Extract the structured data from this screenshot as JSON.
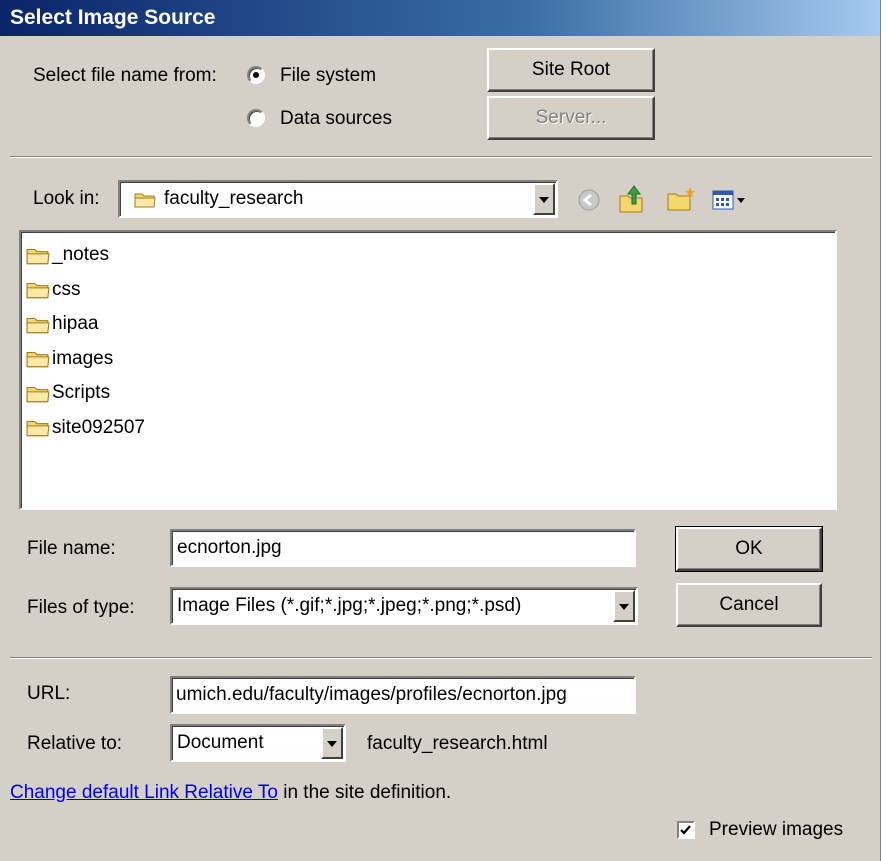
{
  "title": "Select Image Source",
  "select_from": {
    "label": "Select file name from:",
    "options": [
      "File system",
      "Data sources"
    ],
    "selected": "File system"
  },
  "buttons": {
    "site_root": "Site Root",
    "server": "Server...",
    "ok": "OK",
    "cancel": "Cancel"
  },
  "look_in": {
    "label": "Look in:",
    "value": "faculty_research"
  },
  "toolbar_icons": [
    "back-icon",
    "up-folder-icon",
    "new-folder-icon",
    "view-menu-icon"
  ],
  "files": [
    {
      "name": "_notes",
      "type": "folder"
    },
    {
      "name": "css",
      "type": "folder"
    },
    {
      "name": "hipaa",
      "type": "folder"
    },
    {
      "name": "images",
      "type": "folder"
    },
    {
      "name": "Scripts",
      "type": "folder"
    },
    {
      "name": "site092507",
      "type": "folder"
    }
  ],
  "file_name": {
    "label": "File name:",
    "value": "ecnorton.jpg"
  },
  "files_of_type": {
    "label": "Files of type:",
    "value": "Image Files (*.gif;*.jpg;*.jpeg;*.png;*.psd)"
  },
  "url": {
    "label": "URL:",
    "value": "umich.edu/faculty/images/profiles/ecnorton.jpg"
  },
  "relative_to": {
    "label": "Relative to:",
    "value": "Document",
    "document_name": "faculty_research.html"
  },
  "footer": {
    "link_text": "Change default Link Relative To",
    "after_link": " in the site definition."
  },
  "preview": {
    "label": "Preview images",
    "checked": true
  },
  "colors": {
    "dialog_bg": "#d4d0c8",
    "title_start": "#0a246a",
    "title_end": "#a6caf0",
    "link": "#0000ee"
  }
}
